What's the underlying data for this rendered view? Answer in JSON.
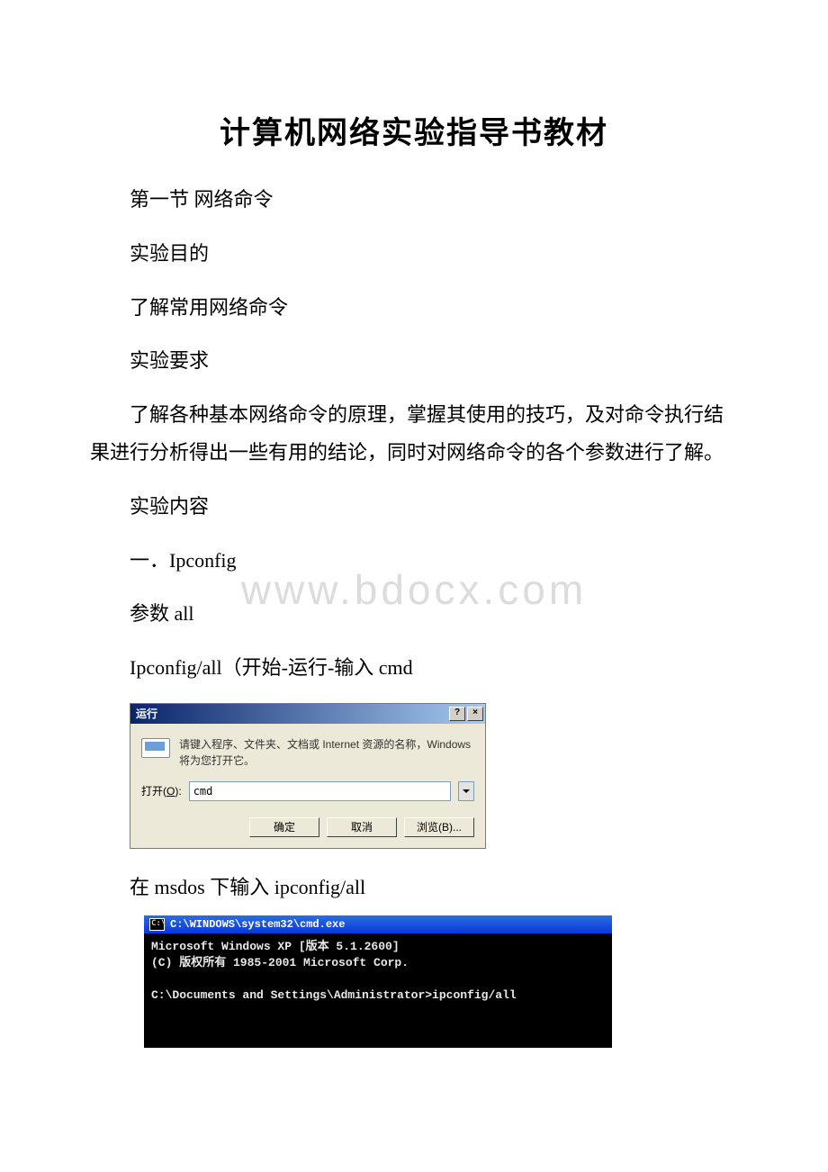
{
  "doc": {
    "title": "计算机网络实验指导书教材",
    "section": "第一节 网络命令",
    "heading_purpose": "实验目的",
    "purpose_text": " 了解常用网络命令",
    "heading_req": "实验要求",
    "req_text": " 了解各种基本网络命令的原理，掌握其使用的技巧，及对命令执行结果进行分析得出一些有用的结论，同时对网络命令的各个参数进行了解。",
    "heading_content": "实验内容",
    "item1": "一．Ipconfig",
    "param_line": "参数 all",
    "ipconfig_line": "Ipconfig/all（开始-运行-输入 cmd",
    "msdos_line": "在 msdos 下输入 ipconfig/all"
  },
  "watermark": "www.bdocx.com",
  "run_dialog": {
    "title": "运行",
    "help_btn": "?",
    "close_btn": "×",
    "description": "请键入程序、文件夹、文档或 Internet 资源的名称，Windows 将为您打开它。",
    "open_label_pre": "打开(",
    "open_label_u": "O",
    "open_label_post": "):",
    "input_value": "cmd",
    "btn_ok": "确定",
    "btn_cancel": "取消",
    "btn_browse": "浏览(B)..."
  },
  "cmd": {
    "title_path": "C:\\WINDOWS\\system32\\cmd.exe",
    "line1": "Microsoft Windows XP [版本 5.1.2600]",
    "line2": "(C) 版权所有 1985-2001 Microsoft Corp.",
    "blank": "",
    "prompt": "C:\\Documents and Settings\\Administrator>ipconfig/all"
  }
}
